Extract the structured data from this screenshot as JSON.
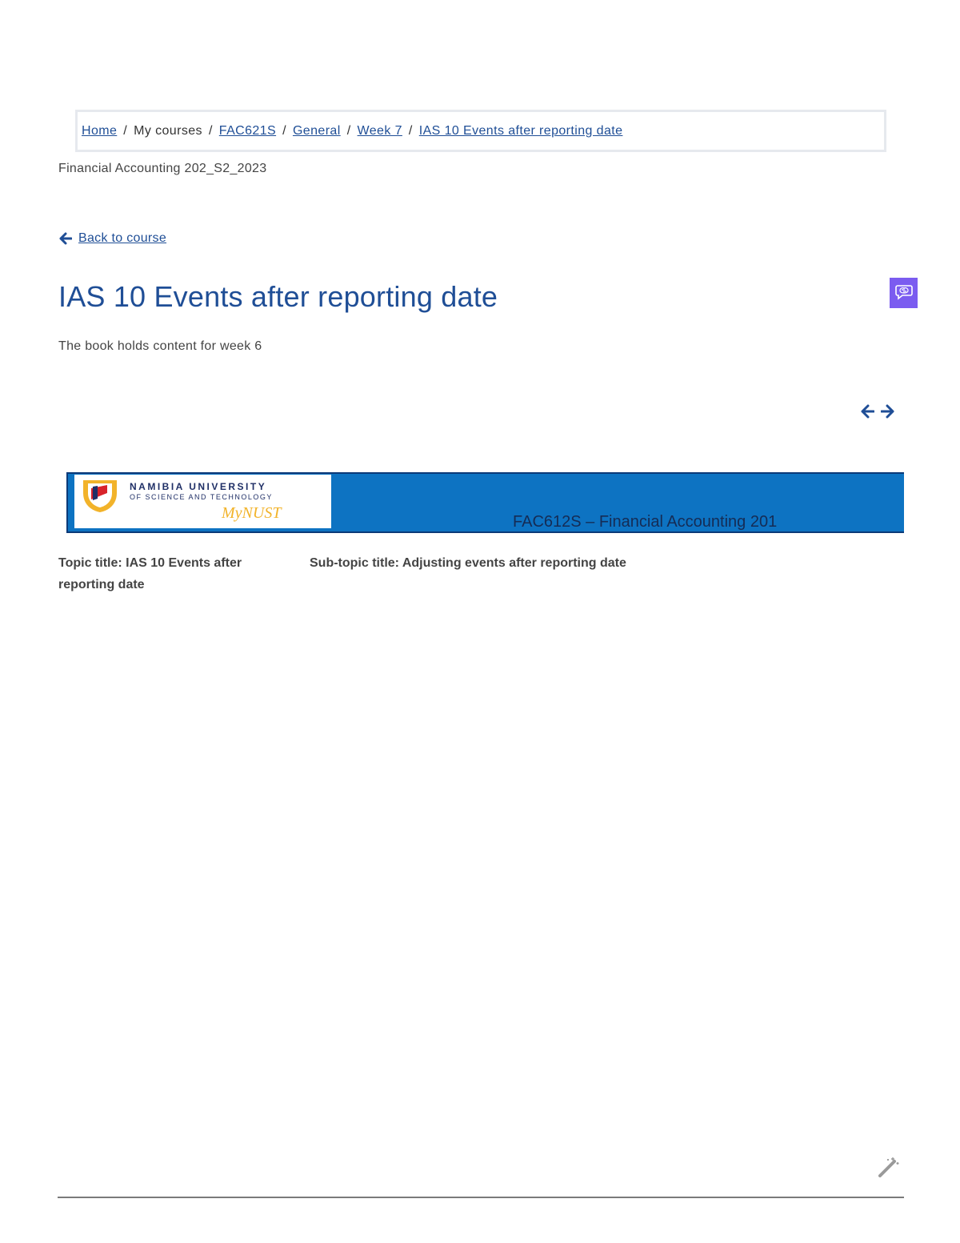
{
  "breadcrumb": {
    "home": "Home",
    "my_courses": "My courses",
    "course_code": "FAC621S",
    "section": "General",
    "week": "Week 7",
    "current": "IAS 10 Events after reporting date",
    "separator": "/"
  },
  "course_full_name": "Financial Accounting 202_S2_2023",
  "back_link": {
    "label": "Back to course",
    "icon": "arrow-left-icon"
  },
  "page_title": "IAS 10 Events after reporting date",
  "description": "The book holds content for week 6",
  "ai_button": {
    "icon": "brain-chat-icon",
    "color": "#7b5cf0"
  },
  "chapter_nav": {
    "previous_icon": "arrow-left-icon",
    "next_icon": "arrow-right-icon"
  },
  "banner": {
    "university_line1": "NAMIBIA UNIVERSITY",
    "university_line2": "OF SCIENCE AND TECHNOLOGY",
    "logo_wordmark": "MyNUST",
    "course_title": "FAC612S – Financial Accounting 201",
    "background_color": "#0d73c2"
  },
  "content": {
    "topic": "Topic title: IAS 10 Events after reporting date",
    "subtopic": "Sub-topic title: Adjusting events after reporting date"
  },
  "footer": {
    "tool_icon": "magic-wand-icon"
  },
  "colors": {
    "link": "#1f4e96",
    "text": "#444444",
    "accent": "#7b5cf0"
  }
}
